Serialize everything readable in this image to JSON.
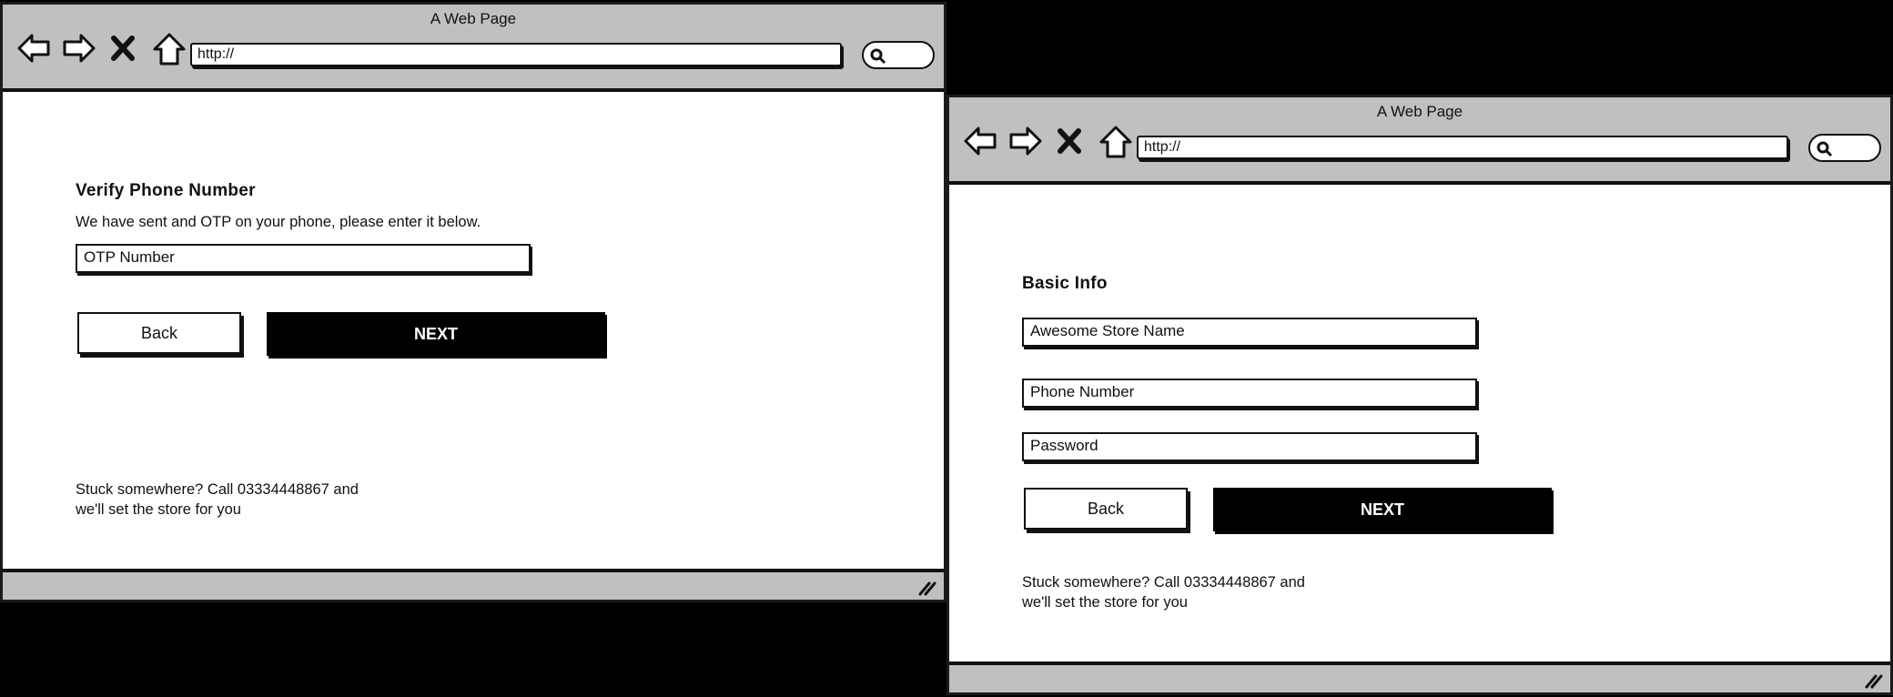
{
  "browser": {
    "title": "A Web Page",
    "url": "http://"
  },
  "verify_screen": {
    "heading": "Verify Phone Number",
    "subtitle": "We have sent and OTP on your phone, please enter it below.",
    "otp_field": "OTP Number",
    "back_label": "Back",
    "next_label": "NEXT",
    "help_line1": "Stuck somewhere? Call 03334448867 and",
    "help_line2": "we'll set the store for you"
  },
  "basic_info_screen": {
    "heading": "Basic Info",
    "store_name_field": "Awesome Store Name",
    "phone_field": "Phone Number",
    "password_field": "Password",
    "back_label": "Back",
    "next_label": "NEXT",
    "help_line1": "Stuck somewhere? Call 03334448867 and",
    "help_line2": "we'll set the store for you"
  }
}
